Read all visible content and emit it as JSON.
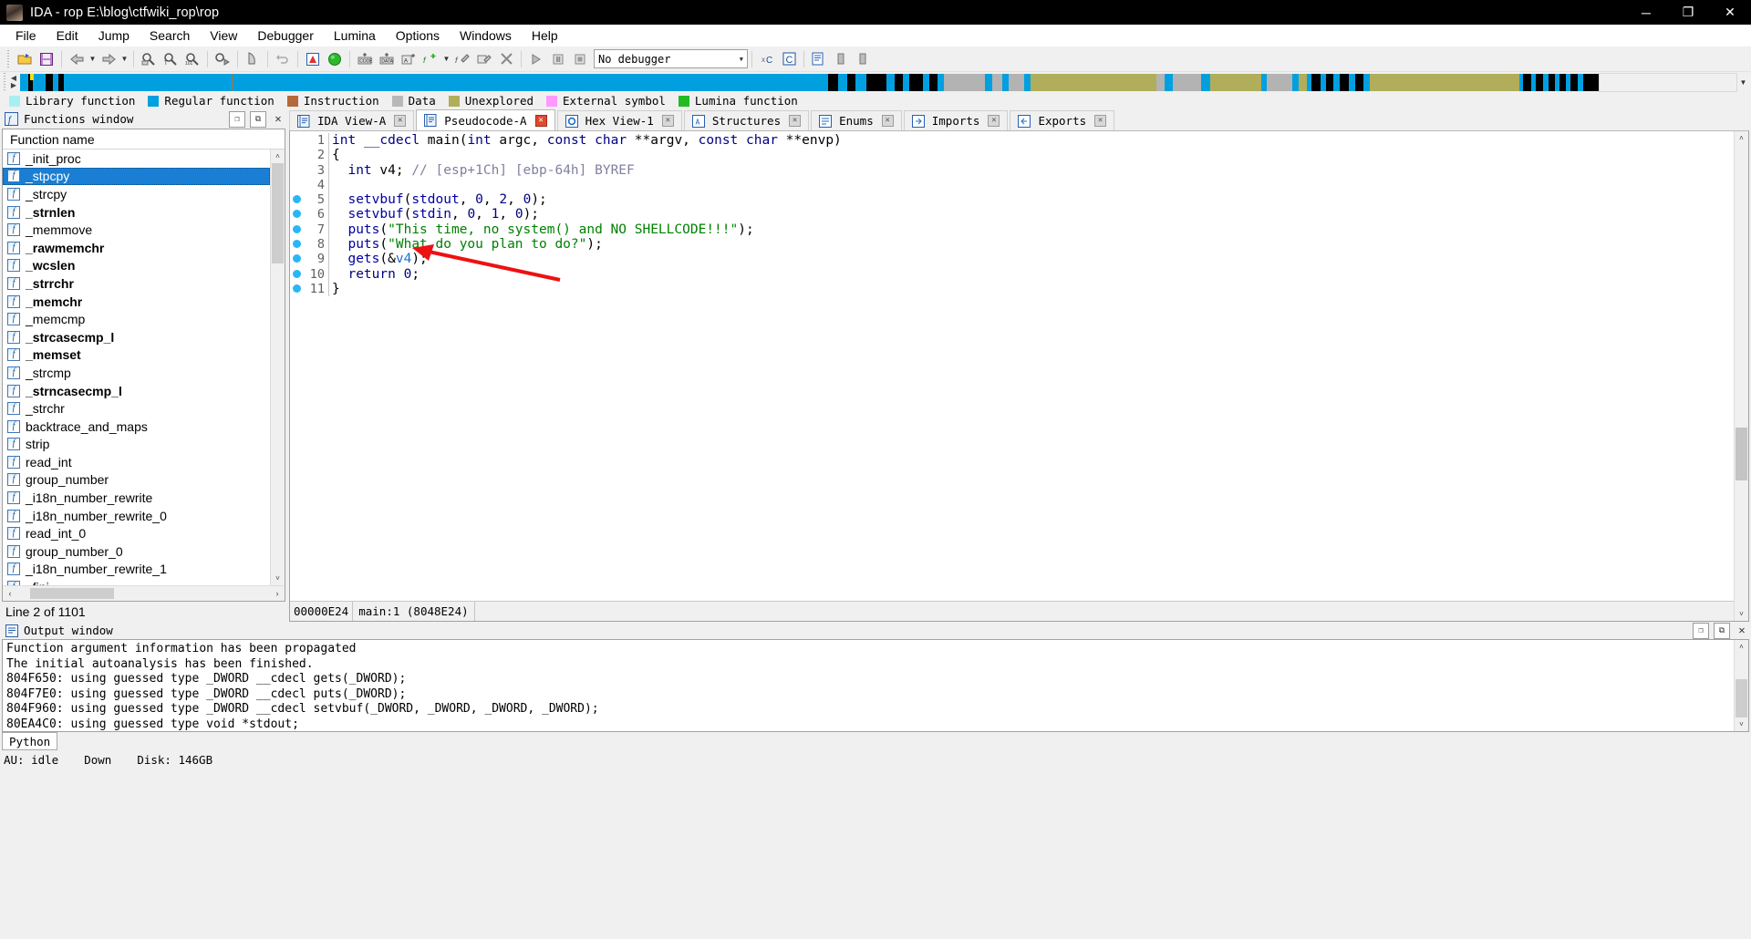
{
  "window": {
    "title": "IDA - rop E:\\blog\\ctfwiki_rop\\rop",
    "app_icon": "ida-logo-icon",
    "minimize": "─",
    "maximize": "❐",
    "close": "✕"
  },
  "menu": [
    {
      "label": "File"
    },
    {
      "label": "Edit"
    },
    {
      "label": "Jump"
    },
    {
      "label": "Search"
    },
    {
      "label": "View"
    },
    {
      "label": "Debugger"
    },
    {
      "label": "Lumina"
    },
    {
      "label": "Options"
    },
    {
      "label": "Windows"
    },
    {
      "label": "Help"
    }
  ],
  "toolbar": {
    "debugger_value": "No debugger",
    "dropdown_caret": "▼"
  },
  "navband": {
    "left_arrow": "◀",
    "right_arrow": "▶",
    "caret": "▼",
    "segments": [
      {
        "x": 0.0,
        "w": 0.5,
        "color": "#00a0e0"
      },
      {
        "x": 0.5,
        "w": 0.3,
        "color": "#000000"
      },
      {
        "x": 0.8,
        "w": 0.5,
        "color": "#00a0e0"
      },
      {
        "x": 1.6,
        "w": 0.5,
        "color": "#000000"
      },
      {
        "x": 2.4,
        "w": 0.4,
        "color": "#000000"
      },
      {
        "x": 3.2,
        "w": 48.0,
        "color": "#00a0e0"
      },
      {
        "x": 51.2,
        "w": 0.6,
        "color": "#000000"
      },
      {
        "x": 52.4,
        "w": 0.5,
        "color": "#000000"
      },
      {
        "x": 53.6,
        "w": 1.3,
        "color": "#000000"
      },
      {
        "x": 55.4,
        "w": 0.5,
        "color": "#000000"
      },
      {
        "x": 56.3,
        "w": 0.9,
        "color": "#000000"
      },
      {
        "x": 57.6,
        "w": 0.5,
        "color": "#000000"
      },
      {
        "x": 58.5,
        "w": 2.6,
        "color": "#b3b3b3"
      },
      {
        "x": 61.6,
        "w": 0.6,
        "color": "#b3b3b3"
      },
      {
        "x": 62.6,
        "w": 1.0,
        "color": "#b3b3b3"
      },
      {
        "x": 64.0,
        "w": 8.0,
        "color": "#b0ae5a"
      },
      {
        "x": 72.0,
        "w": 0.5,
        "color": "#b3b3b3"
      },
      {
        "x": 73.0,
        "w": 1.8,
        "color": "#b3b3b3"
      },
      {
        "x": 75.4,
        "w": 3.2,
        "color": "#b0ae5a"
      },
      {
        "x": 79.0,
        "w": 1.6,
        "color": "#b3b3b3"
      },
      {
        "x": 81.0,
        "w": 0.5,
        "color": "#b0ae5a"
      },
      {
        "x": 81.8,
        "w": 0.6,
        "color": "#000000"
      },
      {
        "x": 82.7,
        "w": 0.5,
        "color": "#000000"
      },
      {
        "x": 83.6,
        "w": 0.6,
        "color": "#000000"
      },
      {
        "x": 84.6,
        "w": 0.5,
        "color": "#000000"
      },
      {
        "x": 85.5,
        "w": 9.5,
        "color": "#b0ae5a"
      },
      {
        "x": 95.2,
        "w": 0.5,
        "color": "#000000"
      },
      {
        "x": 96.0,
        "w": 0.5,
        "color": "#000000"
      },
      {
        "x": 96.8,
        "w": 0.4,
        "color": "#000000"
      },
      {
        "x": 97.5,
        "w": 0.4,
        "color": "#000000"
      },
      {
        "x": 98.2,
        "w": 0.5,
        "color": "#000000"
      },
      {
        "x": 99.0,
        "w": 1.0,
        "color": "#000000"
      }
    ]
  },
  "legend": [
    {
      "label": "Library function",
      "color": "#a8f0f0"
    },
    {
      "label": "Regular function",
      "color": "#00a0e0"
    },
    {
      "label": "Instruction",
      "color": "#b5683a"
    },
    {
      "label": "Data",
      "color": "#b8b8b8"
    },
    {
      "label": "Unexplored",
      "color": "#b0ae5a"
    },
    {
      "label": "External symbol",
      "color": "#ff99ff"
    },
    {
      "label": "Lumina function",
      "color": "#22bb22"
    }
  ],
  "functions_window": {
    "panel_title": "Functions window",
    "panel_icon": "function-window-icon",
    "restore_icon": "❐",
    "float_icon": "⧉",
    "close_icon": "✕",
    "column_header": "Function name",
    "selected_index": 1,
    "bold_indices": [
      3,
      5,
      6,
      7,
      8,
      10,
      11,
      13
    ],
    "items": [
      "_init_proc",
      "_stpcpy",
      "_strcpy",
      "_strnlen",
      "_memmove",
      "_rawmemchr",
      "_wcslen",
      "_strrchr",
      "_memchr",
      "_memcmp",
      "_strcasecmp_l",
      "_memset",
      "_strcmp",
      "_strncasecmp_l",
      "_strchr",
      "backtrace_and_maps",
      "strip",
      "read_int",
      "group_number",
      "_i18n_number_rewrite",
      "_i18n_number_rewrite_0",
      "read_int_0",
      "group_number_0",
      "_i18n_number_rewrite_1",
      "_fini"
    ],
    "status": "Line 2 of 1101",
    "scroll_up": "˄",
    "scroll_down": "˅",
    "scroll_left": "‹",
    "scroll_right": "›"
  },
  "tabs": [
    {
      "label": "IDA View-A",
      "icon": "document-icon",
      "active": false,
      "close": "✕"
    },
    {
      "label": "Pseudocode-A",
      "icon": "document-icon",
      "active": true,
      "close": "✕"
    },
    {
      "label": "Hex View-1",
      "icon": "hexview-icon",
      "active": false,
      "close": "✕"
    },
    {
      "label": "Structures",
      "icon": "structures-icon",
      "active": false,
      "close": "✕"
    },
    {
      "label": "Enums",
      "icon": "enums-icon",
      "active": false,
      "close": "✕"
    },
    {
      "label": "Imports",
      "icon": "imports-icon",
      "active": false,
      "close": "✕"
    },
    {
      "label": "Exports",
      "icon": "exports-icon",
      "active": false,
      "close": "✕"
    }
  ],
  "pseudocode": {
    "lines": [
      {
        "n": "1",
        "bp": false,
        "html": "<span class=\"k\">int</span> <span class=\"k\">__cdecl</span> <span class=\"fn\">main</span>(<span class=\"k\">int</span> argc, <span class=\"k\">const</span> <span class=\"k\">char</span> **argv, <span class=\"k\">const</span> <span class=\"k\">char</span> **envp)"
      },
      {
        "n": "2",
        "bp": false,
        "html": "{"
      },
      {
        "n": "3",
        "bp": false,
        "html": "  <span class=\"k\">int</span> v4; <span class=\"cm\">// [esp+1Ch] [ebp-64h] BYREF</span>"
      },
      {
        "n": "4",
        "bp": false,
        "html": ""
      },
      {
        "n": "5",
        "bp": true,
        "html": "  <span class=\"call\">setvbuf</span>(<span class=\"call\">stdout</span>, <span class=\"num\">0</span>, <span class=\"num\">2</span>, <span class=\"num\">0</span>);"
      },
      {
        "n": "6",
        "bp": true,
        "html": "  <span class=\"call\">setvbuf</span>(<span class=\"call\">stdin</span>, <span class=\"num\">0</span>, <span class=\"num\">1</span>, <span class=\"num\">0</span>);"
      },
      {
        "n": "7",
        "bp": true,
        "html": "  <span class=\"call\">puts</span>(<span class=\"str\">\"This time, no system() and NO SHELLCODE!!!\"</span>);"
      },
      {
        "n": "8",
        "bp": true,
        "html": "  <span class=\"call\">puts</span>(<span class=\"str\">\"What do you plan to do?\"</span>);"
      },
      {
        "n": "9",
        "bp": true,
        "html": "  <span class=\"call\">gets</span>(&amp;<span class=\"var\">v4</span>);"
      },
      {
        "n": "10",
        "bp": true,
        "html": "  <span class=\"k\">return</span> <span class=\"num\">0</span>;"
      },
      {
        "n": "11",
        "bp": true,
        "html": "}"
      }
    ],
    "status_address": "00000E24",
    "status_symbol": "main:1  (8048E24)"
  },
  "annotation": {
    "arrow_color": "#ee1111",
    "name": "red-arrow-pointing-to-gets"
  },
  "output_window": {
    "panel_title": "Output window",
    "panel_icon": "output-window-icon",
    "restore_icon": "❐",
    "float_icon": "⧉",
    "close_icon": "✕",
    "lines": [
      "Function argument information has been propagated",
      "The initial autoanalysis has been finished.",
      "804F650: using guessed type _DWORD __cdecl gets(_DWORD);",
      "804F7E0: using guessed type _DWORD __cdecl puts(_DWORD);",
      "804F960: using guessed type _DWORD __cdecl setvbuf(_DWORD, _DWORD, _DWORD, _DWORD);",
      "80EA4C0: using guessed type void *stdout;"
    ],
    "console_tab": "Python"
  },
  "statusbar": {
    "au": "AU: idle",
    "direction": "Down",
    "disk": "Disk: 146GB"
  }
}
